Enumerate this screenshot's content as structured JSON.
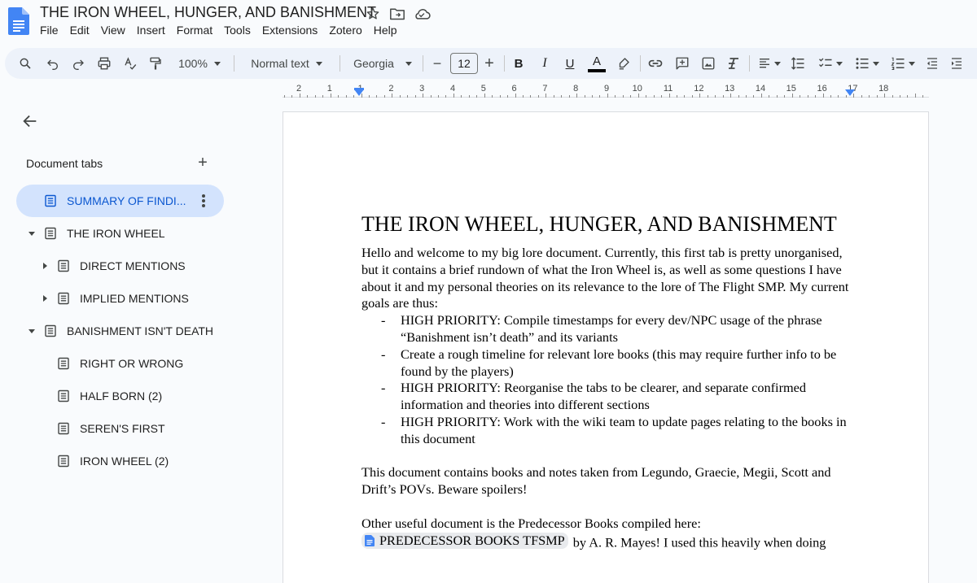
{
  "window": {
    "title": "THE IRON WHEEL, HUNGER, AND BANISHMENT"
  },
  "menu": [
    "File",
    "Edit",
    "View",
    "Insert",
    "Format",
    "Tools",
    "Extensions",
    "Zotero",
    "Help"
  ],
  "toolbar": {
    "zoom": "100%",
    "style": "Normal text",
    "font": "Georgia",
    "font_size": "12",
    "minus": "−",
    "plus": "+",
    "bold": "B",
    "italic": "I",
    "underline": "U",
    "text_color_label": "A",
    "text_color": "#000000"
  },
  "ruler": {
    "numbers": [
      "2",
      "1",
      "1",
      "2",
      "3",
      "4",
      "5",
      "6",
      "7",
      "8",
      "9",
      "10",
      "11",
      "12",
      "13",
      "14",
      "15",
      "16",
      "17",
      "18"
    ]
  },
  "sidebar": {
    "heading": "Document tabs",
    "add_label": "+",
    "tabs": [
      {
        "label": "SUMMARY OF FINDI...",
        "level": 0,
        "expand": "none",
        "selected": true
      },
      {
        "label": "THE IRON WHEEL",
        "level": 0,
        "expand": "expanded",
        "selected": false
      },
      {
        "label": "DIRECT MENTIONS",
        "level": 1,
        "expand": "collapsed",
        "selected": false
      },
      {
        "label": "IMPLIED MENTIONS",
        "level": 1,
        "expand": "collapsed",
        "selected": false
      },
      {
        "label": "BANISHMENT ISN'T DEATH",
        "level": 0,
        "expand": "expanded",
        "selected": false
      },
      {
        "label": "RIGHT OR WRONG",
        "level": 1,
        "expand": "none",
        "selected": false
      },
      {
        "label": "HALF BORN (2)",
        "level": 1,
        "expand": "none",
        "selected": false
      },
      {
        "label": "SEREN'S FIRST",
        "level": 1,
        "expand": "none",
        "selected": false
      },
      {
        "label": "IRON WHEEL (2)",
        "level": 1,
        "expand": "none",
        "selected": false
      }
    ]
  },
  "document": {
    "heading": "THE IRON WHEEL, HUNGER, AND BANISHMENT",
    "intro": "Hello and welcome to my big lore document. Currently, this first tab is pretty unorganised, but it contains a brief rundown of what the Iron Wheel is, as well as some questions I have about it and my personal theories on its relevance to the lore of The Flight SMP. My current goals are thus:",
    "goals": [
      "HIGH PRIORITY: Compile timestamps for every dev/NPC usage of the phrase “Banishment isn’t death” and its variants",
      "Create a rough timeline for relevant lore books (this may require further info to be found by the players)",
      "HIGH PRIORITY: Reorganise the tabs to be clearer, and separate confirmed information and theories into different sections",
      "HIGH PRIORITY: Work with the wiki team to update pages relating to the books in this document"
    ],
    "para2": "This document contains books and notes taken from Legundo, Graecie, Megii, Scott and Drift’s POVs. Beware spoilers!",
    "para3": "Other useful document is the Predecessor Books compiled here:",
    "link_chip": "PREDECESSOR BOOKS TFSMP",
    "para3_tail": " by A. R. Mayes! I used this heavily when doing"
  },
  "colors": {
    "accent": "#0b57d0",
    "selected_tab_bg": "#d3e3fd",
    "toolbar_bg": "#edf2fa",
    "docs_blue": "#4285f4"
  }
}
